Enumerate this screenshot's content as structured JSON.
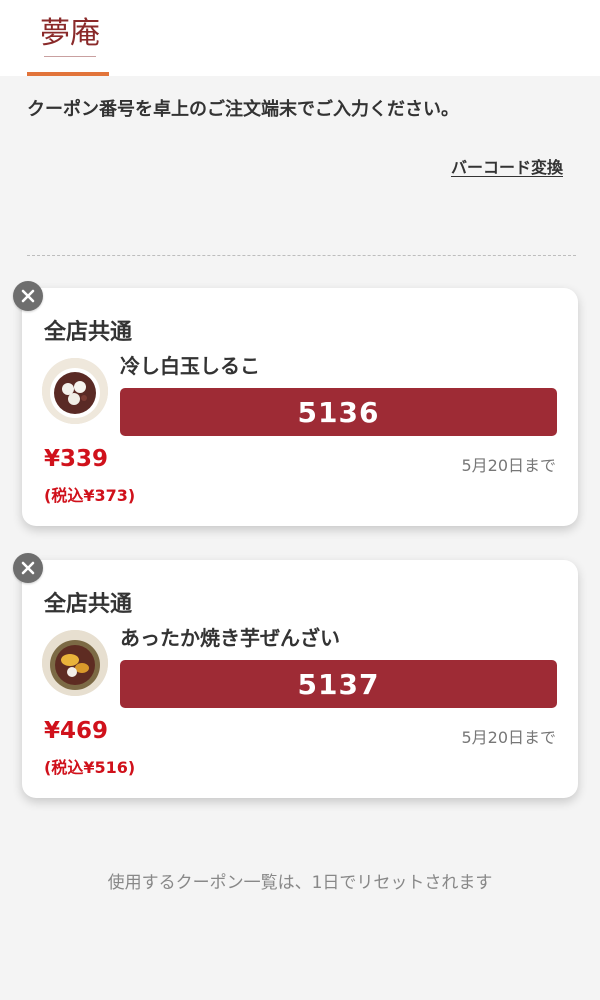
{
  "header": {
    "logo_text": "夢庵",
    "accent_color": "#e2743a"
  },
  "instruction": "クーポン番号を卓上のご注文端末でご入力ください。",
  "barcode_link": "バーコード変換",
  "coupons": [
    {
      "store_scope": "全店共通",
      "item_name": "冷し白玉しるこ",
      "code": "5136",
      "price": "¥339",
      "price_with_tax": "(税込¥373)",
      "expiry": "5月20日まで",
      "thumb_icon": "shiratama-shiruko-photo"
    },
    {
      "store_scope": "全店共通",
      "item_name": "あったか焼き芋ぜんざい",
      "code": "5137",
      "price": "¥469",
      "price_with_tax": "(税込¥516)",
      "expiry": "5月20日まで",
      "thumb_icon": "yakiimo-zenzai-photo"
    }
  ],
  "footer_note": "使用するクーポン一覧は、1日でリセットされます",
  "colors": {
    "code_bg": "#9e2b35",
    "price": "#d0111b",
    "close_bg": "#6e6e6e"
  },
  "icons": {
    "close": "close-icon"
  }
}
